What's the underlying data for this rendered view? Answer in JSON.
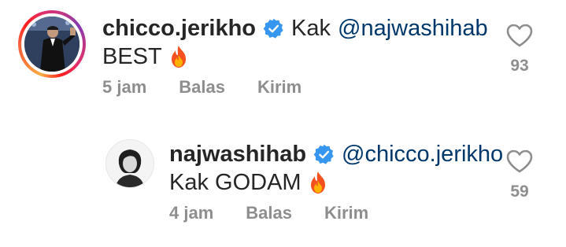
{
  "comments": [
    {
      "username": "chicco.jerikho",
      "verified": true,
      "prefix": "Kak",
      "mention": "@najwashihab",
      "text": "BEST",
      "emoji": "fire-icon",
      "time": "5 jam",
      "reply_label": "Balas",
      "send_label": "Kirim",
      "likes": "93",
      "has_story_ring": true
    },
    {
      "username": "najwashihab",
      "verified": true,
      "prefix": "",
      "mention": "@chicco.jerikho",
      "text": "Kak GODAM",
      "emoji": "fire-icon",
      "time": "4 jam",
      "reply_label": "Balas",
      "send_label": "Kirim",
      "likes": "59",
      "has_story_ring": false
    }
  ],
  "colors": {
    "verified": "#3797f0",
    "mention": "#00376b",
    "meta": "#8e8e8e",
    "text": "#262626"
  }
}
